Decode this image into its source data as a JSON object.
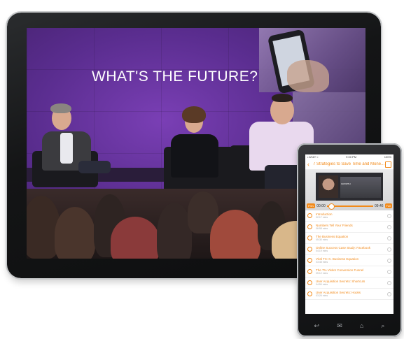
{
  "tablet": {
    "headline": "WHAT'S THE FUTURE?"
  },
  "phone": {
    "status": {
      "carrier": "• AT&T ≈",
      "time": "9:00 PM",
      "battery": "100%"
    },
    "nav": {
      "back_icon": "chevron-left-icon",
      "title": "7 Strategies to Save Time and Mone...",
      "share_icon": "share-icon"
    },
    "video": {
      "caption": "GROWTH",
      "left_pill": "Prev",
      "elapsed": "00:00",
      "remaining": "09:46",
      "right_pill": "Full",
      "progress": 0.05
    },
    "lessons": [
      {
        "title": "Introduction",
        "duration": "02:17 mins"
      },
      {
        "title": "Numbers Tell Your Friends",
        "duration": "06:58 mins"
      },
      {
        "title": "The Business Equation",
        "duration": "05:30 mins"
      },
      {
        "title": "Online Success Case Study: Facebook",
        "duration": "04:19 mins"
      },
      {
        "title": "Viral TX: K. Business Equation",
        "duration": "03:48 mins"
      },
      {
        "title": "The 7% Visitor Conversion Funnel",
        "duration": "05:12 mins"
      },
      {
        "title": "User Acquisition Secrets: Shortcuts",
        "duration": "04:50 mins"
      },
      {
        "title": "User Acquisition Secrets: Hooks",
        "duration": "03:26 mins"
      }
    ],
    "hw_keys": {
      "back": "↩",
      "mail": "✉",
      "home": "⌂",
      "search": "⌕"
    }
  }
}
